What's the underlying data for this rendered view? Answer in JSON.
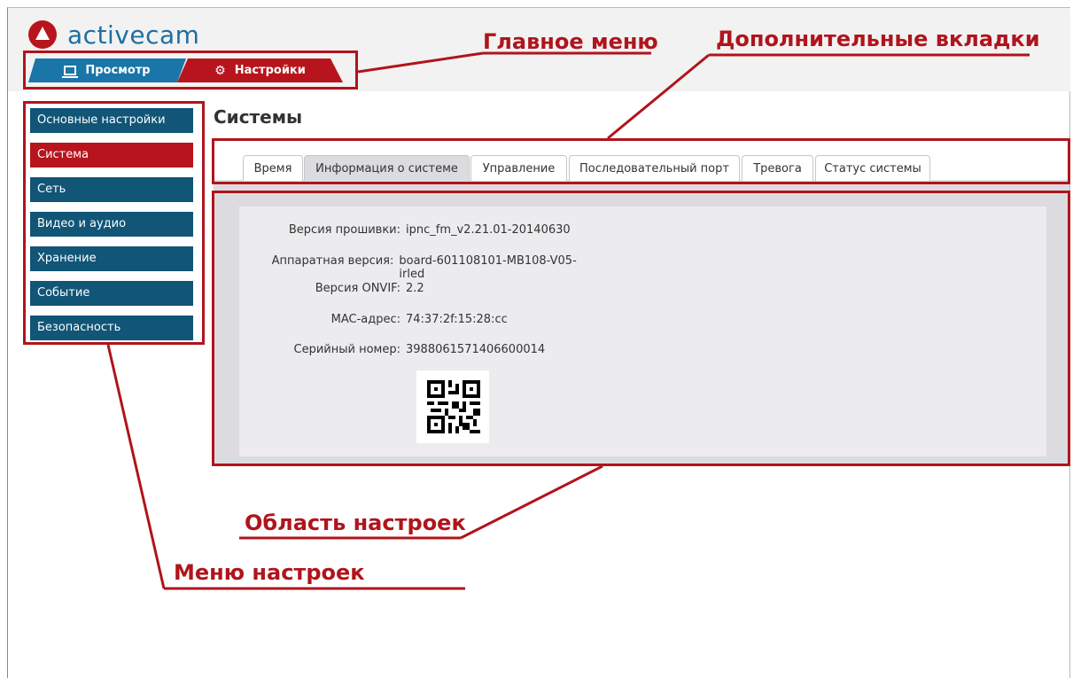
{
  "app": {
    "logo_text": "activecam",
    "brand_color": "#b8141d",
    "accent_color": "#1a75a8"
  },
  "main_tabs": [
    {
      "label": "Просмотр",
      "icon": "monitor-icon"
    },
    {
      "label": "Настройки",
      "icon": "gear-icon"
    }
  ],
  "sidebar": {
    "items": [
      {
        "label": "Основные настройки"
      },
      {
        "label": "Система",
        "active": true
      },
      {
        "label": "Сеть"
      },
      {
        "label": "Видео и аудио"
      },
      {
        "label": "Хранение"
      },
      {
        "label": "Событие"
      },
      {
        "label": "Безопасность"
      }
    ]
  },
  "page_title": "Системы",
  "subtabs": [
    {
      "label": "Время"
    },
    {
      "label": "Информация о системе",
      "active": true
    },
    {
      "label": "Управление"
    },
    {
      "label": "Последовательный порт"
    },
    {
      "label": "Тревога"
    },
    {
      "label": "Статус системы"
    }
  ],
  "system_info": [
    {
      "label": "Версия прошивки:",
      "value": "ipnc_fm_v2.21.01-20140630"
    },
    {
      "label": "Аппаратная версия:",
      "value": "board-601108101-MB108-V05-irled"
    },
    {
      "label": "Версия ONVIF:",
      "value": "2.2"
    },
    {
      "label": "MAC-адрес:",
      "value": "74:37:2f:15:28:cc"
    },
    {
      "label": "Серийный номер:",
      "value": "3988061571406600014"
    }
  ],
  "annotations": {
    "main_menu": "Главное меню",
    "extra_tabs": "Дополнительные вкладки",
    "settings_area": "Область настроек",
    "settings_menu": "Меню настроек",
    "color": "#b0141c"
  }
}
